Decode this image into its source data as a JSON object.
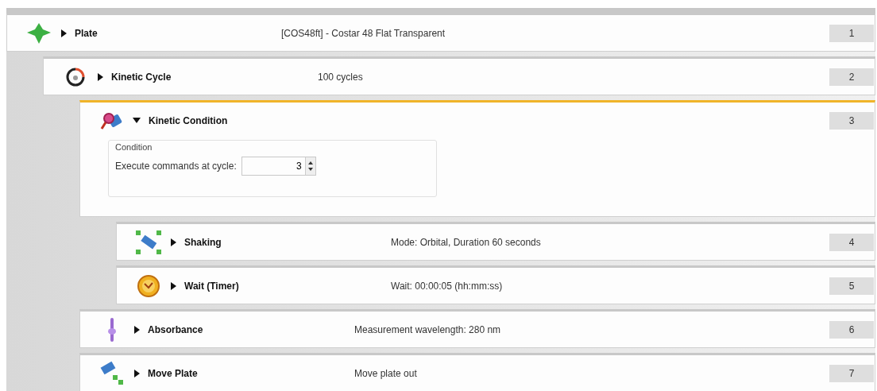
{
  "steps": [
    {
      "kind": "plate",
      "name": "Plate",
      "description": "[COS48ft] - Costar 48 Flat Transparent",
      "number": "1",
      "expanded": false,
      "selected": false,
      "children": [
        {
          "kind": "cycle",
          "name": "Kinetic Cycle",
          "description": "100 cycles",
          "number": "2",
          "expanded": false,
          "selected": false,
          "children": [
            {
              "kind": "condition",
              "name": "Kinetic Condition",
              "number": "3",
              "expanded": true,
              "selected": true,
              "condition": {
                "group": "Condition",
                "label": "Execute commands at cycle:",
                "value": "3"
              },
              "children": [
                {
                  "kind": "shaking",
                  "name": "Shaking",
                  "description": "Mode: Orbital, Duration 60 seconds",
                  "number": "4",
                  "expanded": false,
                  "selected": false
                },
                {
                  "kind": "timer",
                  "name": "Wait (Timer)",
                  "description": "Wait: 00:00:05 (hh:mm:ss)",
                  "number": "5",
                  "expanded": false,
                  "selected": false
                }
              ]
            },
            {
              "kind": "absorbance",
              "name": "Absorbance",
              "description": "Measurement wavelength: 280 nm",
              "number": "6",
              "expanded": false,
              "selected": false
            },
            {
              "kind": "move",
              "name": "Move Plate",
              "description": "Move plate out",
              "number": "7",
              "expanded": false,
              "selected": false
            }
          ]
        }
      ]
    }
  ]
}
